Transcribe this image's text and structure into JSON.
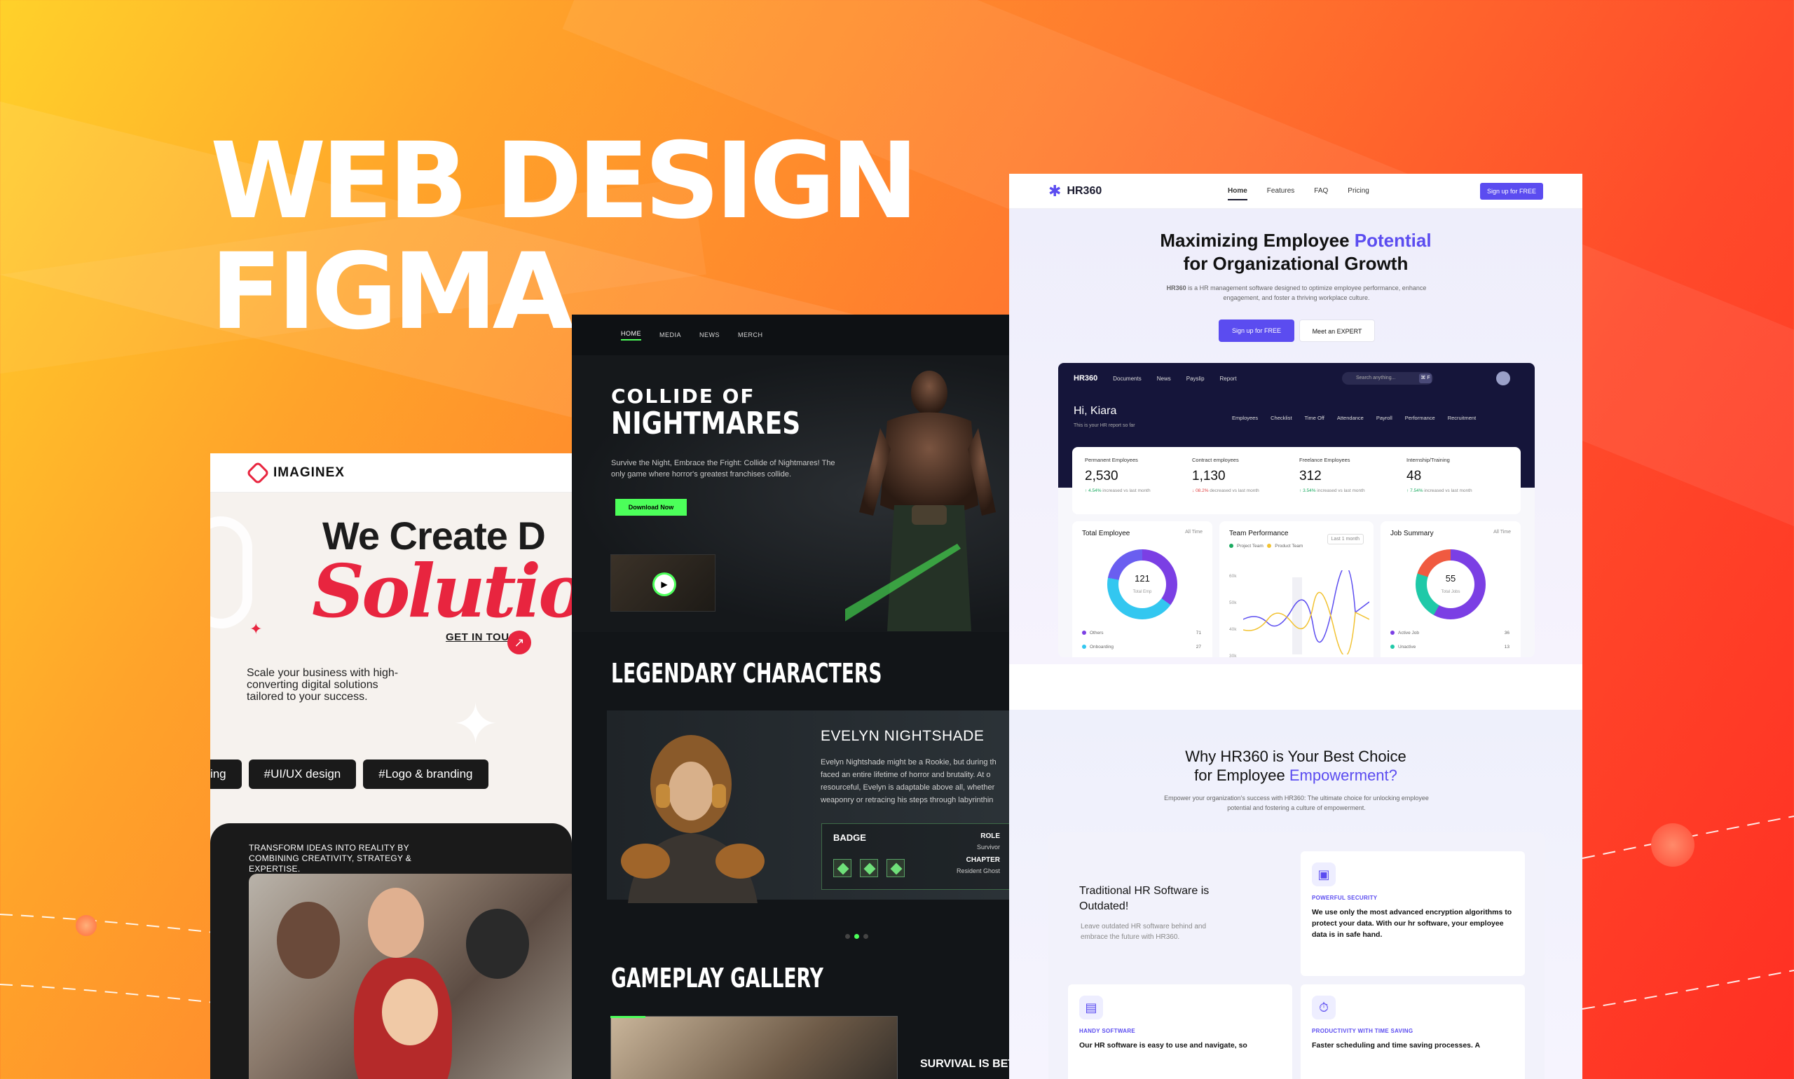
{
  "headline": {
    "line1": "WEB DESIGN",
    "line2": "FIGMA"
  },
  "imaginex": {
    "logo": "IMAGINEX",
    "hero_line1": "We Create D",
    "hero_line2": "Solutio",
    "cta": "GET IN TOUCH",
    "description": "Scale your business with high-converting digital solutions tailored to your success.",
    "tags": [
      "diting",
      "#UI/UX design",
      "#Logo & branding"
    ],
    "dark_text": "TRANSFORM IDEAS INTO REALITY BY COMBINING CREATIVITY, STRATEGY & EXPERTISE.",
    "accent": "#e8253f"
  },
  "game": {
    "nav": [
      "HOME",
      "MEDIA",
      "NEWS",
      "MERCH"
    ],
    "title1": "COLLIDE OF",
    "title2": "NIGHTMARES",
    "subtitle": "Survive the Night, Embrace the Fright: Collide of Nightmares! The only game where horror's greatest franchises collide.",
    "download": "Download Now",
    "section_characters": "LEGENDARY CHARACTERS",
    "character_name": "EVELYN NIGHTSHADE",
    "character_desc": "Evelyn Nightshade might be a Rookie, but during th faced an entire lifetime of horror and brutality. At o resourceful, Evelyn is adaptable above all, whether weaponry or retracing his steps through labyrinthin",
    "badge_label": "BADGE",
    "role_label": "ROLE",
    "role_value": "Survivor",
    "chapter_label": "CHAPTER",
    "chapter_value": "Resident Ghost",
    "section_gallery": "GAMEPLAY GALLERY",
    "gallery_caption": "SURVIVAL IS BET",
    "accent": "#4cff5a"
  },
  "hr360": {
    "logo": "HR360",
    "nav": [
      "Home",
      "Features",
      "FAQ",
      "Pricing"
    ],
    "signup": "Sign up for FREE",
    "hero_l1a": "Maximizing Employee ",
    "hero_l1b": "Potential",
    "hero_l2": "for Organizational Growth",
    "lead_brand": "HR360",
    "lead": " is a HR management software designed to optimize employee performance, enhance engagement, and foster a thriving workplace culture.",
    "btn_primary": "Sign up for FREE",
    "btn_secondary": "Meet an EXPERT",
    "dashboard": {
      "nav": [
        "Documents",
        "News",
        "Payslip",
        "Report"
      ],
      "search": "Search anything...",
      "kbd": "⌘ F",
      "greeting": "Hi, Kiara",
      "greeting_sub": "This is your HR report so far",
      "tabs": [
        "Employees",
        "Checklist",
        "Time Off",
        "Attendance",
        "Payroll",
        "Performance",
        "Recruitment"
      ],
      "stats": [
        {
          "label": "Permanent Employees",
          "value": "2,530",
          "change": "4.54%",
          "dir": "up",
          "note": " increased vs last month"
        },
        {
          "label": "Contract employees",
          "value": "1,130",
          "change": "08.2%",
          "dir": "down",
          "note": " decreased vs last month"
        },
        {
          "label": "Freelance Employees",
          "value": "312",
          "change": "3.54%",
          "dir": "up",
          "note": " increased vs last month"
        },
        {
          "label": "Internship/Training",
          "value": "48",
          "change": "7.54%",
          "dir": "up",
          "note": " increased vs last month"
        }
      ],
      "total_employee": {
        "title": "Total Employee",
        "filter": "All Time",
        "value": "121",
        "unit": "Total Emp",
        "legend": [
          {
            "name": "Others",
            "value": "71"
          },
          {
            "name": "Onboarding",
            "value": "27"
          }
        ]
      },
      "team_performance": {
        "title": "Team Performance",
        "filter": "Last 1 month",
        "series": [
          "Project Team",
          "Product Team"
        ],
        "yticks": [
          "60k",
          "50k",
          "40k",
          "30k"
        ]
      },
      "job_summary": {
        "title": "Job Summary",
        "filter": "All Time",
        "value": "55",
        "unit": "Total Jobs",
        "legend": [
          {
            "name": "Active Job",
            "value": "36"
          },
          {
            "name": "Unactive",
            "value": "13"
          }
        ]
      }
    },
    "why_l1": "Why HR360 is Your Best Choice",
    "why_l2a": "for Employee ",
    "why_l2b": "Empowerment?",
    "why_sub": "Empower your organization's success with HR360: The ultimate choice for unlocking employee potential and fostering a culture of empowerment.",
    "feature_head": "Traditional HR Software is Outdated!",
    "feature_sub": "Leave outdated HR software behind and embrace the future with HR360.",
    "features": [
      {
        "label": "POWERFUL SECURITY",
        "text": "We use only the most advanced encryption algorithms to protect your data. With our hr software, your employee data is in safe hand."
      },
      {
        "label": "HANDY SOFTWARE",
        "text": "Our HR software is easy to use and navigate, so"
      },
      {
        "label": "PRODUCTIVITY WITH TIME SAVING",
        "text": "Faster scheduling and time saving processes. A"
      }
    ],
    "accent": "#5b4cf0"
  }
}
